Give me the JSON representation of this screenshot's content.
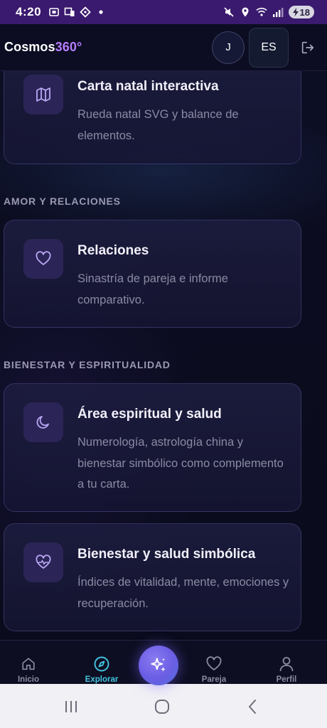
{
  "status_bar": {
    "time": "4:20",
    "battery": "18"
  },
  "header": {
    "logo_main": "Cosmos",
    "logo_accent": "360°",
    "avatar_initial": "J",
    "language": "ES"
  },
  "cards": [
    {
      "title": "Carta natal interactiva",
      "description": "Rueda natal SVG y balance de elementos.",
      "icon": "map-icon"
    },
    {
      "title": "Relaciones",
      "description": "Sinastría de pareja e informe comparativo.",
      "icon": "heart-icon"
    },
    {
      "title": "Área espiritual y salud",
      "description": "Numerología, astrología china y bienestar simbólico como complemento a tu carta.",
      "icon": "moon-icon"
    },
    {
      "title": "Bienestar y salud simbólica",
      "description": "Índices de vitalidad, mente, emociones y recuperación.",
      "icon": "heart-pulse-icon"
    }
  ],
  "sections": {
    "love": "AMOR Y RELACIONES",
    "wellness": "BIENESTAR Y ESPIRITUALIDAD"
  },
  "bottom_nav": {
    "items": [
      {
        "label": "Inicio",
        "icon": "home-icon"
      },
      {
        "label": "Explorar",
        "icon": "compass-icon",
        "active": true
      },
      {
        "label": "Pareja",
        "icon": "heart-icon"
      },
      {
        "label": "Perfil",
        "icon": "user-icon"
      }
    ],
    "fab_icon": "sparkles-icon"
  },
  "colors": {
    "accent_purple": "#b57dff",
    "active_nav": "#45c6e2",
    "status_bar": "#3a1a6e"
  }
}
